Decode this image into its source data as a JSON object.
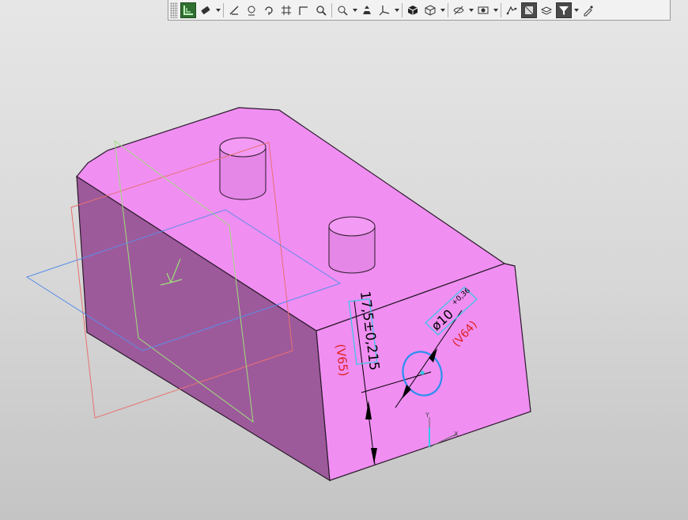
{
  "toolbar": {
    "icons": [
      "grip-icon",
      "select-filter-icon",
      "eraser-icon",
      "dropdown-arrow",
      "measure-icon",
      "view-orient-icon",
      "view-rotate-icon",
      "grid-icon",
      "snap-corner-icon",
      "zoom-icon",
      "zoom-window-icon",
      "dropdown-arrow",
      "pan-icon",
      "axis-triad-icon",
      "dropdown-arrow",
      "shaded-cube-icon",
      "wireframe-cube-icon",
      "dropdown-arrow",
      "hide-icon",
      "dropdown-arrow",
      "section-view-icon",
      "dropdown-arrow",
      "layers-icon",
      "appearance-icon",
      "layer-stack-icon",
      "filter-icon",
      "dropdown-arrow",
      "eyedropper-icon"
    ]
  },
  "model": {
    "body_color": "#ee8ef0",
    "dim_height_text": "17,5±0,215",
    "dim_height_ref": "(V65)",
    "dim_dia_text": "ø10",
    "dim_dia_tol": "+0,36",
    "dim_dia_ref": "(V64)",
    "axis_y": "Y",
    "axis_x": "X"
  }
}
